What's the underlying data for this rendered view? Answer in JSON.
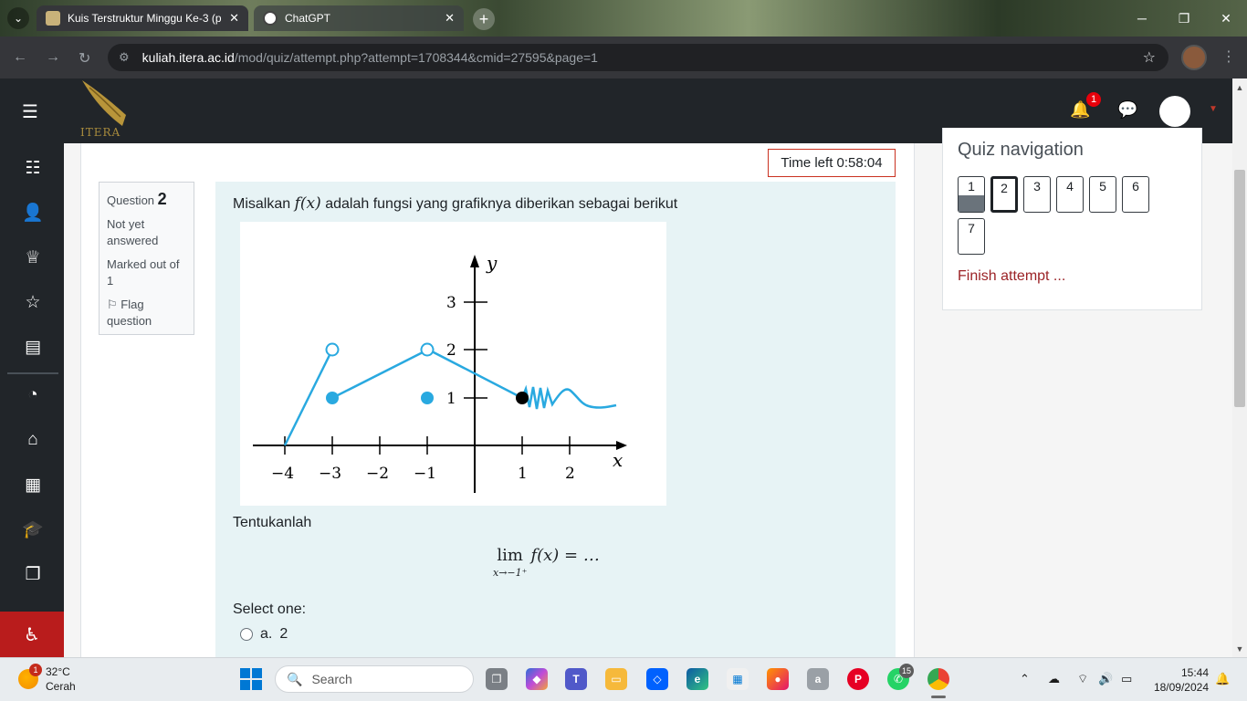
{
  "browser": {
    "tabs": [
      {
        "title": "Kuis Terstruktur Minggu Ke-3 (p",
        "active": true
      },
      {
        "title": "ChatGPT",
        "active": false
      }
    ],
    "url_host": "kuliah.itera.ac.id",
    "url_path": "/mod/quiz/attempt.php?attempt=1708344&cmid=27595&page=1"
  },
  "site": {
    "logo_text": "ITERA",
    "notification_count": "1"
  },
  "quiz": {
    "time_left": "Time left 0:58:04",
    "question_label": "Question",
    "question_number": "2",
    "state": "Not yet answered",
    "grade": "Marked out of 1",
    "flag_label": "Flag question",
    "text_before": "Misalkan",
    "text_math": "f(x)",
    "text_after": "adalah fungsi yang grafiknya diberikan sebagai berikut",
    "instruction": "Tentukanlah",
    "limit_op": "lim",
    "limit_sub": "x→−1⁺",
    "limit_expr": "f(x) = …",
    "select_prompt": "Select one:",
    "options": [
      {
        "letter": "a.",
        "value": "2"
      }
    ]
  },
  "graph": {
    "y_label": "y",
    "x_label": "x",
    "x_ticks": [
      "−4",
      "−3",
      "−2",
      "−1",
      "1",
      "2"
    ],
    "y_ticks": [
      "1",
      "2",
      "3"
    ]
  },
  "quiz_nav": {
    "title": "Quiz navigation",
    "questions": [
      "1",
      "2",
      "3",
      "4",
      "5",
      "6",
      "7"
    ],
    "answered": [
      "1"
    ],
    "current": "2",
    "finish_label": "Finish attempt ..."
  },
  "taskbar": {
    "weather_temp": "32°C",
    "weather_desc": "Cerah",
    "weather_badge": "1",
    "search_placeholder": "Search",
    "whatsapp_badge": "15",
    "time": "15:44",
    "date": "18/09/2024"
  },
  "colors": {
    "navbar": "#212529",
    "accent_red": "#ca3120",
    "formulation_bg": "#e7f3f5",
    "graph_blue": "#29a9e0"
  }
}
